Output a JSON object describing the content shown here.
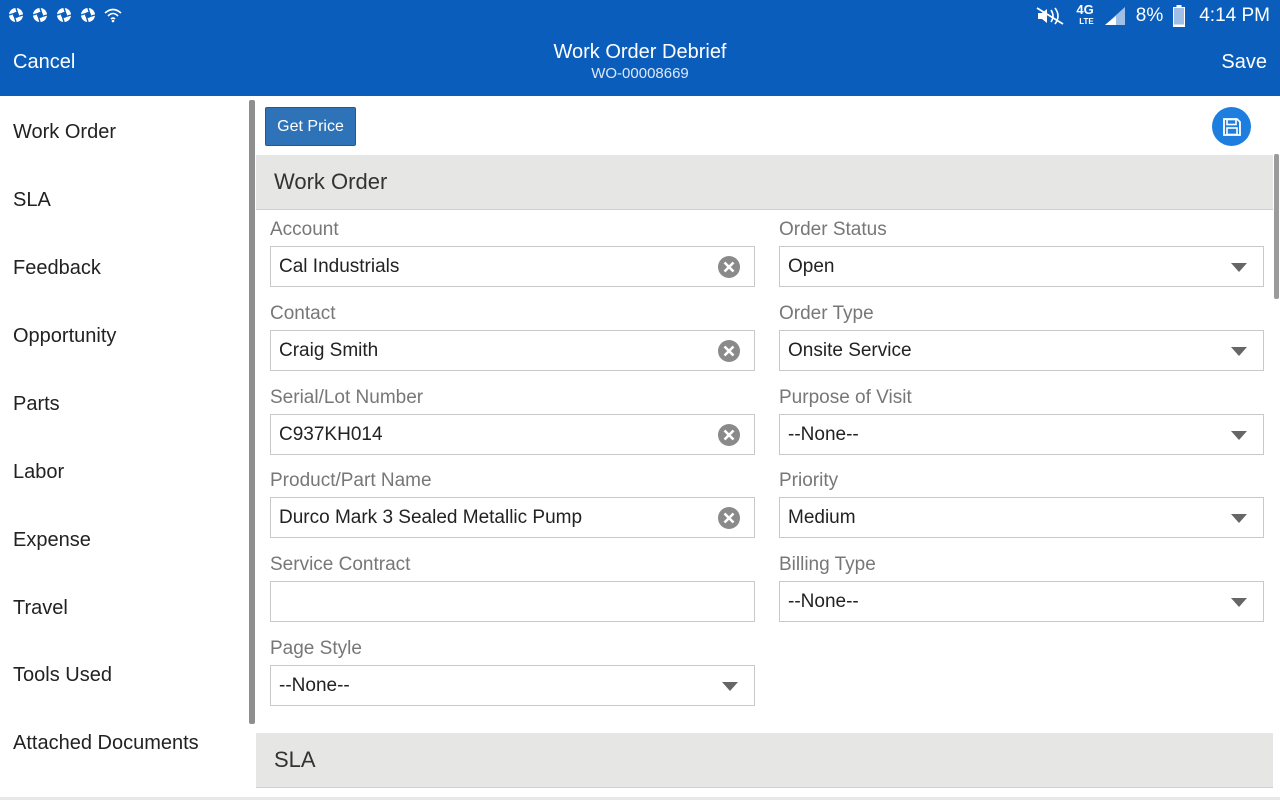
{
  "status_bar": {
    "battery": "8%",
    "time": "4:14 PM",
    "network": "4G",
    "network_sub": "LTE",
    "left_icons": [
      "aperture-icon",
      "aperture-icon",
      "aperture-icon",
      "aperture-icon",
      "wifi-icon"
    ],
    "right_icons": [
      "mute-icon",
      "signal-icon",
      "battery-icon"
    ]
  },
  "header": {
    "title": "Work Order Debrief",
    "subtitle": "WO-00008669",
    "cancel_label": "Cancel",
    "save_label": "Save",
    "color": "#0b5dbb"
  },
  "sidebar": {
    "items": [
      {
        "label": "Work Order"
      },
      {
        "label": "SLA"
      },
      {
        "label": "Feedback"
      },
      {
        "label": "Opportunity"
      },
      {
        "label": "Parts"
      },
      {
        "label": "Labor"
      },
      {
        "label": "Expense"
      },
      {
        "label": "Travel"
      },
      {
        "label": "Tools Used"
      },
      {
        "label": "Attached Documents"
      }
    ]
  },
  "toolbar": {
    "get_price_label": "Get Price",
    "save_icon": "floppy-disk-icon"
  },
  "sections": {
    "work_order": "Work Order",
    "sla": "SLA"
  },
  "fields": {
    "account": {
      "label": "Account",
      "value": "Cal Industrials"
    },
    "contact": {
      "label": "Contact",
      "value": "Craig Smith"
    },
    "serial": {
      "label": "Serial/Lot Number",
      "value": "C937KH014"
    },
    "product": {
      "label": "Product/Part Name",
      "value": "Durco Mark 3 Sealed Metallic Pump"
    },
    "service_contract": {
      "label": "Service Contract",
      "value": ""
    },
    "page_style": {
      "label": "Page Style",
      "value": "--None--"
    },
    "order_status": {
      "label": "Order Status",
      "value": "Open"
    },
    "order_type": {
      "label": "Order Type",
      "value": "Onsite Service"
    },
    "purpose": {
      "label": "Purpose of Visit",
      "value": "--None--"
    },
    "priority": {
      "label": "Priority",
      "value": "Medium"
    },
    "billing_type": {
      "label": "Billing Type",
      "value": "--None--"
    }
  }
}
